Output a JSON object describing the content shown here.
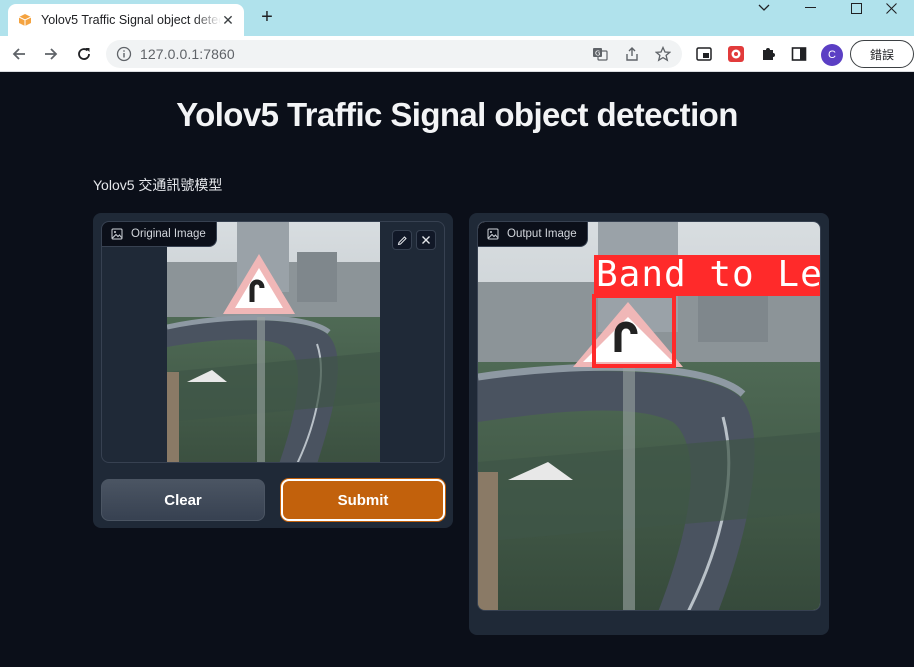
{
  "browser": {
    "tab_title": "Yolov5 Traffic Signal object detection",
    "url": "127.0.0.1:7860",
    "profile_initial": "C",
    "error_chip": "錯誤",
    "icons": [
      "favicon-icon",
      "close-icon",
      "new-tab-icon",
      "back-icon",
      "forward-icon",
      "reload-icon",
      "info-icon",
      "translate-icon",
      "share-icon",
      "star-icon",
      "picture-in-picture-icon",
      "extension-red-icon",
      "puzzle-icon",
      "sidepanel-icon",
      "minimize-icon",
      "maximize-icon",
      "window-close-icon",
      "chevron-down-icon"
    ]
  },
  "page": {
    "title": "Yolov5 Traffic Signal object detection",
    "description": "Yolov5 交通訊號模型"
  },
  "input_panel": {
    "label": "Original Image",
    "clear_label": "Clear",
    "submit_label": "Submit"
  },
  "output_panel": {
    "label": "Output Image",
    "detection_label": "Band to Le"
  },
  "colors": {
    "background": "#0b0f19",
    "panel": "#1f2937",
    "submit": "#c2610c",
    "detection_box": "#ff2a2a",
    "tabstrip": "#b0e2ec"
  }
}
